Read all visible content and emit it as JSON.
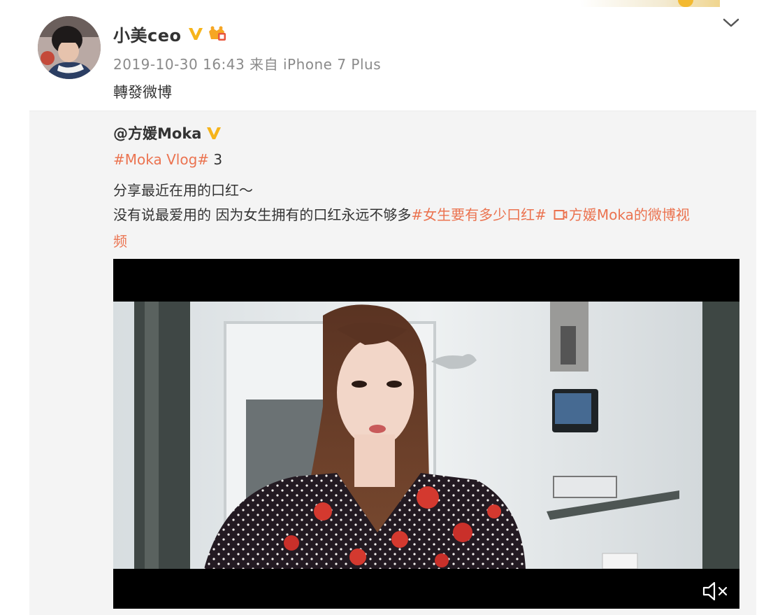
{
  "post": {
    "username": "小美ceo",
    "timestamp": "2019-10-30 16:43",
    "source": "来自 iPhone 7 Plus",
    "repost_text": "轉發微博"
  },
  "quoted": {
    "username": "@方媛Moka",
    "hashtag_vlog": "#Moka Vlog#",
    "vlog_number": " 3",
    "line2": "分享最近在用的口红～",
    "line3_text": "没有说最爱用的 因为女生拥有的口红永远不够多",
    "hashtag_lipstick": "#女生要有多少口红#",
    "video_link_label": "方媛Moka的微博视",
    "video_link_label_cont": "频"
  },
  "colors": {
    "link": "#eb7350",
    "verified": "#f6b41a",
    "quoted_bg": "#f4f4f4"
  },
  "icons": [
    "verified-badge-icon",
    "vip-icon",
    "chevron-down-icon",
    "video-link-icon",
    "mute-icon"
  ]
}
